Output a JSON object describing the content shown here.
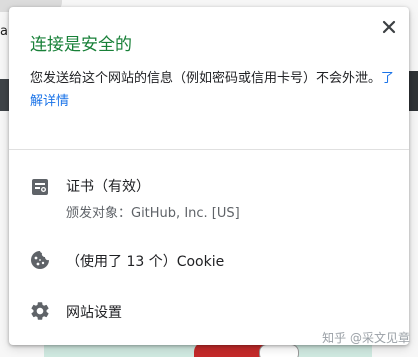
{
  "popup": {
    "title": "连接是安全的",
    "description": "您发送给这个网站的信息（例如密码或信用卡号）不会外泄。",
    "learn_more": "了解详情",
    "close_icon": "close-icon",
    "title_color": "#188038",
    "link_color": "#1a73e8"
  },
  "certificate": {
    "icon": "certificate-icon",
    "label": "证书（有效）",
    "issued_to": "颁发对象：GitHub, Inc. [US]"
  },
  "cookies": {
    "icon": "cookie-icon",
    "label": "（使用了 13 个）Cookie"
  },
  "site_settings": {
    "icon": "gear-icon",
    "label": "网站设置"
  },
  "background": {
    "watermark": "知乎 @采文见章"
  }
}
